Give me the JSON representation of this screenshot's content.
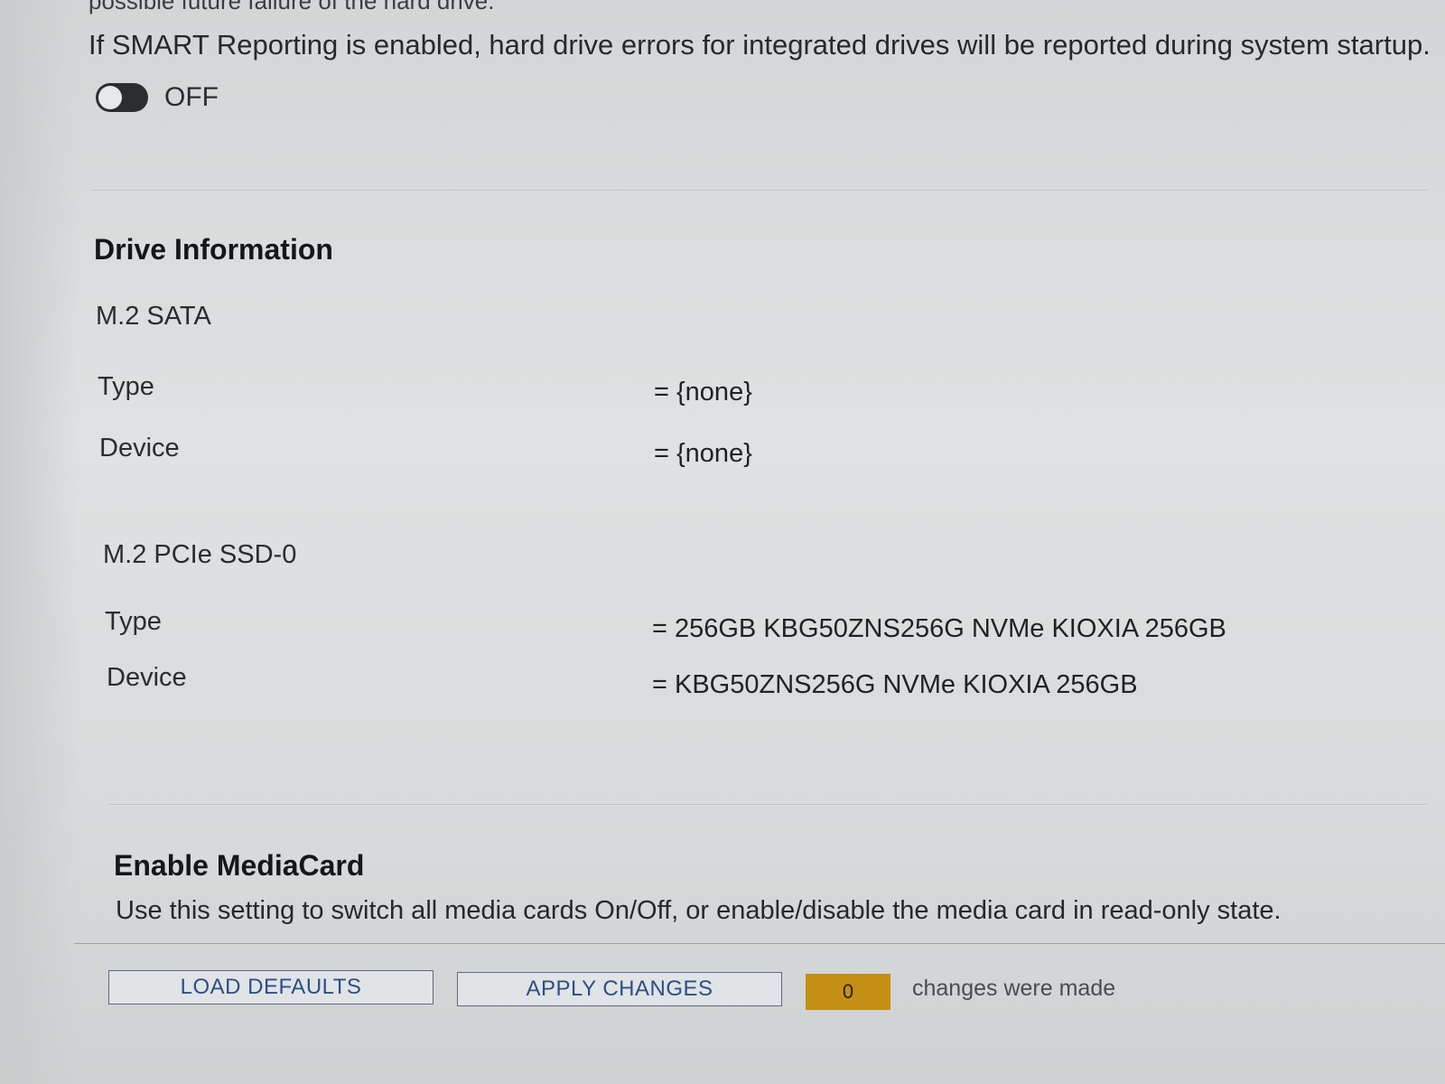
{
  "smart": {
    "cut_text": "possible future failure of the hard drive.",
    "description": "If SMART Reporting is enabled, hard drive errors for integrated drives will be reported during system startup.",
    "toggle_state": "OFF"
  },
  "drive_info": {
    "heading": "Drive Information",
    "groups": [
      {
        "title": "M.2 SATA",
        "rows": [
          {
            "label": "Type",
            "value": "= {none}"
          },
          {
            "label": "Device",
            "value": "= {none}"
          }
        ]
      },
      {
        "title": "M.2 PCIe SSD-0",
        "rows": [
          {
            "label": "Type",
            "value": "= 256GB KBG50ZNS256G NVMe KIOXIA 256GB"
          },
          {
            "label": "Device",
            "value": "= KBG50ZNS256G NVMe KIOXIA 256GB"
          }
        ]
      }
    ]
  },
  "media_card": {
    "heading": "Enable MediaCard",
    "description": "Use this setting to switch all media cards On/Off, or enable/disable the media card in read-only state."
  },
  "footer": {
    "load_defaults_label": "LOAD DEFAULTS",
    "apply_changes_label": "APPLY CHANGES",
    "change_count": "0",
    "changes_text": "changes were made"
  },
  "colors": {
    "counter_bg": "#c48f14",
    "button_text": "#2e4e86",
    "toggle_off": "#2b2d30"
  }
}
